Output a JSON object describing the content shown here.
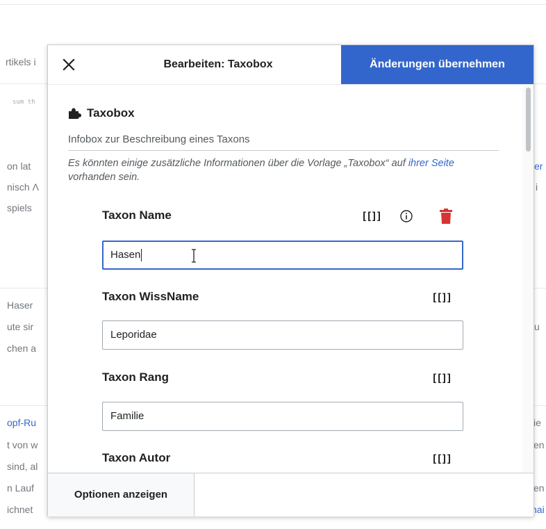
{
  "background": {
    "left_fragments": [
      "rtikels i",
      "sum th",
      "on lat",
      "nisch Λ",
      "spiels",
      "Haser",
      "ute sir",
      "chen a",
      "opf-Ru",
      "t von w",
      "sind, al",
      "n Lauf",
      "ichnet"
    ],
    "right_fragments": [
      "er",
      "i",
      "u",
      "ie",
      "en",
      "en",
      "hai"
    ]
  },
  "dialog": {
    "title": "Bearbeiten: Taxobox",
    "apply_label": "Änderungen übernehmen",
    "close_icon": "close-icon",
    "template": {
      "name": "Taxobox",
      "icon": "puzzle-icon",
      "description": "Infobox zur Beschreibung eines Taxons",
      "note_before_link": "Es könnten einige zusätzliche Informationen über die Vorlage „Taxobox“ auf ",
      "note_link": "ihrer Seite",
      "note_after_link": " vorhanden sein."
    },
    "params": [
      {
        "label": "Taxon Name",
        "value": "Hasen",
        "focused": true
      },
      {
        "label": "Taxon WissName",
        "value": "Leporidae",
        "focused": false
      },
      {
        "label": "Taxon Rang",
        "value": "Familie",
        "focused": false
      },
      {
        "label": "Taxon Autor",
        "value": "",
        "focused": false
      }
    ],
    "wiki_link_button": "[[]]",
    "options_label": "Optionen anzeigen"
  },
  "colors": {
    "accent": "#3366cc",
    "delete": "#d73333",
    "text": "#202122",
    "muted": "#54595d"
  }
}
